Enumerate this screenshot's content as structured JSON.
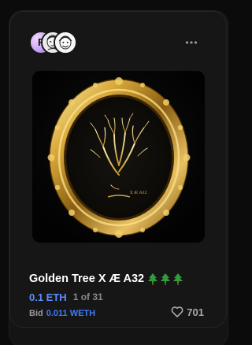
{
  "card": {
    "avatars": [
      {
        "name": "creator-avatar",
        "letter": "F"
      },
      {
        "name": "collector-avatar-1"
      },
      {
        "name": "collector-avatar-2"
      }
    ],
    "menu_icon": "more-dots-icon",
    "artwork": {
      "frame": "gold-oval-frame",
      "subject": "golden-tree",
      "caption": "X Æ A32"
    },
    "title": "Golden Tree X Æ A32",
    "title_emojis": [
      "evergreen-tree-emoji",
      "evergreen-tree-emoji",
      "evergreen-tree-emoji"
    ],
    "price": "0.1 ETH",
    "edition": "1 of 31",
    "bid_label": "Bid",
    "bid_value": "0.011 WETH",
    "like_icon": "heart-icon",
    "like_count": "701"
  },
  "colors": {
    "background": "#0b0b0b",
    "card": "#161616",
    "price": "#5b8cff",
    "bid": "#3f7bff",
    "muted": "#8a8a8a",
    "gold": "#d4a83a",
    "tree_green": "#2e9d3a"
  }
}
